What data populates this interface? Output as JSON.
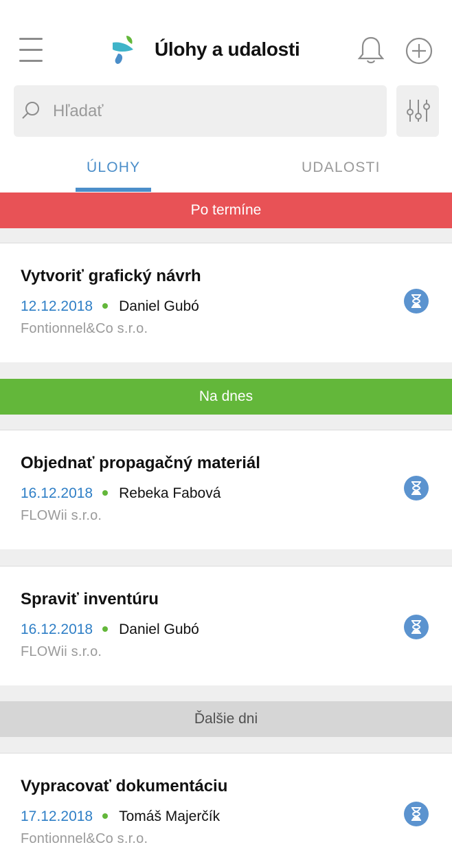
{
  "header": {
    "title": "Úlohy a udalosti",
    "menu_icon": "hamburger-menu-icon",
    "logo_icon": "app-logo-icon",
    "notification_icon": "bell-icon",
    "add_icon": "plus-circle-icon"
  },
  "search": {
    "placeholder": "Hľadať",
    "icon": "search-icon",
    "filter_icon": "filter-sliders-icon"
  },
  "tabs": [
    {
      "label": "ÚLOHY",
      "active": true
    },
    {
      "label": "UDALOSTI",
      "active": false
    }
  ],
  "sections": [
    {
      "label": "Po termíne",
      "color": "#e85256",
      "tasks": [
        {
          "title": "Vytvoriť grafický návrh",
          "date": "12.12.2018",
          "person": "Daniel Gubó",
          "company": "Fontionnel&Co s.r.o.",
          "status_icon": "hourglass-icon"
        }
      ]
    },
    {
      "label": "Na dnes",
      "color": "#63b73a",
      "tasks": [
        {
          "title": "Objednať propagačný materiál",
          "date": "16.12.2018",
          "person": "Rebeka Fabová",
          "company": "FLOWii s.r.o.",
          "status_icon": "hourglass-icon"
        },
        {
          "title": "Spraviť inventúru",
          "date": "16.12.2018",
          "person": "Daniel Gubó",
          "company": "FLOWii s.r.o.",
          "status_icon": "hourglass-icon"
        }
      ]
    },
    {
      "label": "Ďalšie dni",
      "color": "#d6d6d6",
      "tasks": [
        {
          "title": "Vypracovať dokumentáciu",
          "date": "17.12.2018",
          "person": "Tomáš Majerčík",
          "company": "Fontionnel&Co s.r.o.",
          "status_icon": "hourglass-icon"
        }
      ]
    }
  ],
  "colors": {
    "accent": "#4b8ec9",
    "date": "#2f7fc6",
    "dot": "#63b73a",
    "status_icon_bg": "#5b93cf"
  }
}
